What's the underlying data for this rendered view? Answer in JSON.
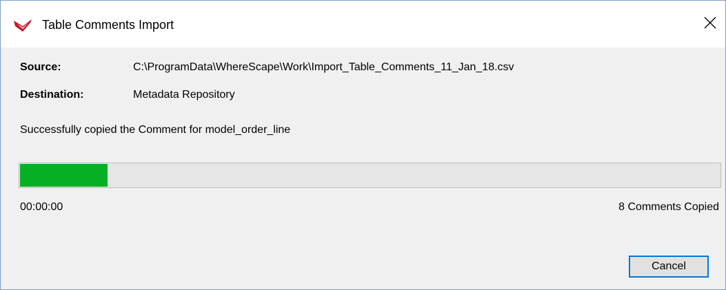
{
  "window": {
    "title": "Table Comments Import",
    "close_glyph": "✕"
  },
  "source": {
    "label": "Source:",
    "value": "C:\\ProgramData\\WhereScape\\Work\\Import_Table_Comments_11_Jan_18.csv"
  },
  "destination": {
    "label": "Destination:",
    "value": "Metadata Repository"
  },
  "status_message": "Successfully copied the Comment for model_order_line",
  "progress": {
    "fraction": 0.125,
    "color": "#06b025",
    "elapsed": "00:00:00",
    "summary": "8 Comments Copied"
  },
  "buttons": {
    "cancel_label": "Cancel"
  },
  "icons": {
    "app": "wherescape-logo-icon",
    "close": "close-icon"
  }
}
